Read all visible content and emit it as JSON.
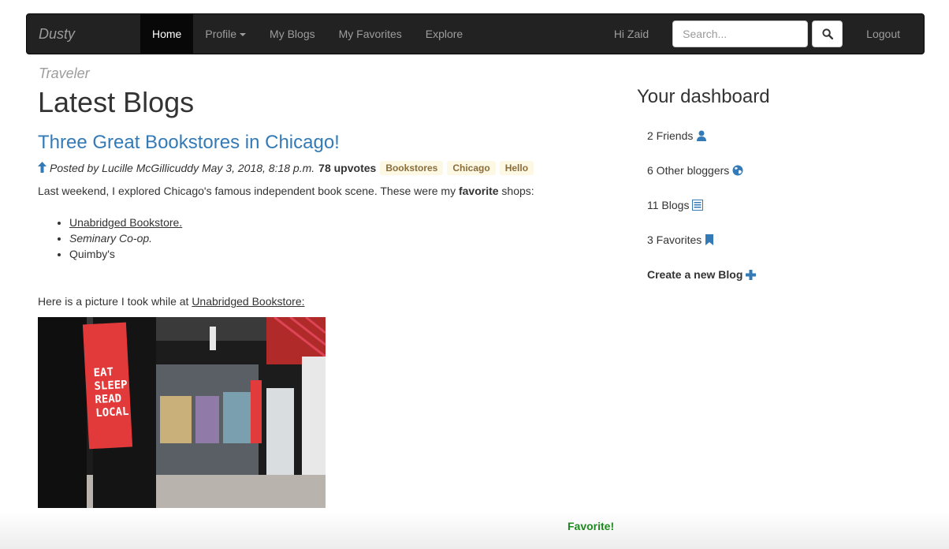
{
  "nav": {
    "brand": "Dusty Traveler",
    "items": [
      {
        "label": "Home"
      },
      {
        "label": "Profile"
      },
      {
        "label": "My Blogs"
      },
      {
        "label": "My Favorites"
      },
      {
        "label": "Explore"
      }
    ],
    "greeting": "Hi Zaid",
    "search_placeholder": "Search...",
    "logout": "Logout"
  },
  "main": {
    "title": "Latest Blogs",
    "post": {
      "title": "Three Great Bookstores in Chicago!",
      "posted": "Posted by Lucille McGillicuddy May 3, 2018, 8:18 p.m.",
      "upvotes": "78 upvotes",
      "tags": [
        "Bookstores",
        "Chicago",
        "Hello"
      ],
      "intro_before": "Last weekend, I explored Chicago's famous independent book scene. These were my ",
      "intro_bold": "favorite",
      "intro_after": " shops:",
      "shops": [
        "Unabridged Bookstore. ",
        "Seminary Co-op.",
        "Quimby's"
      ],
      "picture_text": "Here is a picture I took while at ",
      "picture_link": "Unabridged Bookstore:",
      "photo_sign": [
        "EAT",
        "SLEEP",
        "READ",
        "LOCAL"
      ]
    },
    "favorite": "Favorite!"
  },
  "dashboard": {
    "title": "Your dashboard",
    "friends": "2 Friends",
    "others": "6 Other bloggers",
    "blogs": "11 Blogs",
    "favorites": "3 Favorites",
    "create": "Create a new Blog"
  },
  "colors": {
    "link": "#337ab7",
    "navbar": "#222222",
    "favorite": "#1e8a1e",
    "tag_bg": "#fcf8e3"
  }
}
